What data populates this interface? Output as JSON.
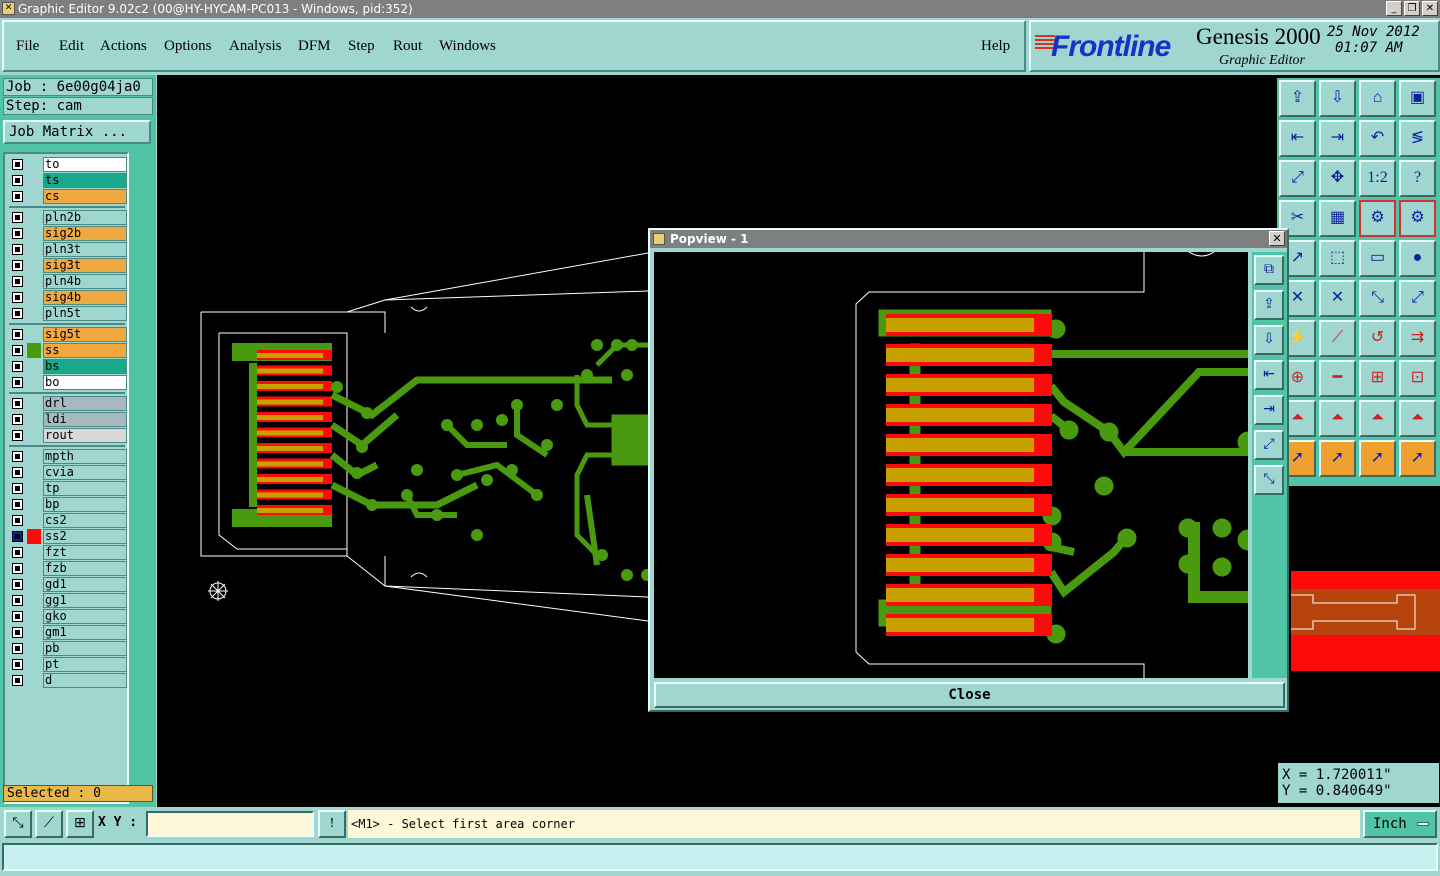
{
  "window": {
    "title": "Graphic Editor 9.02c2 (00@HY-HYCAM-PC013 - Windows, pid:352)"
  },
  "menu": {
    "file": "File",
    "edit": "Edit",
    "actions": "Actions",
    "options": "Options",
    "analysis": "Analysis",
    "dfm": "DFM",
    "step": "Step",
    "rout": "Rout",
    "windows": "Windows",
    "help": "Help"
  },
  "brand": {
    "logo": "Frontline",
    "product": "Genesis 2000",
    "subtitle": "Graphic Editor",
    "date": "25 Nov 2012",
    "time": "01:07 AM"
  },
  "job": {
    "job_label": "Job : 6e00g04ja0",
    "step_label": "Step: cam",
    "matrix_button": "Job Matrix ..."
  },
  "layers": [
    {
      "name": "to",
      "color": "#ffffff",
      "mark": ""
    },
    {
      "name": "ts",
      "color": "#1aa88a",
      "mark": ""
    },
    {
      "name": "cs",
      "color": "#f0a840",
      "mark": "✎"
    },
    {
      "name": "pln2b",
      "color": "#9fd6d0",
      "mark": ""
    },
    {
      "name": "sig2b",
      "color": "#f0a840",
      "mark": "✎"
    },
    {
      "name": "pln3t",
      "color": "#9fd6d0",
      "mark": ""
    },
    {
      "name": "sig3t",
      "color": "#f0a840",
      "mark": ""
    },
    {
      "name": "pln4b",
      "color": "#9fd6d0",
      "mark": ""
    },
    {
      "name": "sig4b",
      "color": "#f0a840",
      "mark": ""
    },
    {
      "name": "pln5t",
      "color": "#9fd6d0",
      "mark": ""
    },
    {
      "name": "sig5t",
      "color": "#f0a840",
      "mark": "✎"
    },
    {
      "name": "ss",
      "color": "#f0a840",
      "mark": ""
    },
    {
      "name": "bs",
      "color": "#1aa88a",
      "mark": ""
    },
    {
      "name": "bo",
      "color": "#ffffff",
      "mark": "✎"
    },
    {
      "name": "drl",
      "color": "#a8b8c0",
      "mark": ""
    },
    {
      "name": "ldi",
      "color": "#a8b8c0",
      "mark": ""
    },
    {
      "name": "rout",
      "color": "#d8d8d8",
      "mark": ""
    },
    {
      "name": "mpth",
      "color": "#9fd6d0",
      "mark": ""
    },
    {
      "name": "cvia",
      "color": "#9fd6d0",
      "mark": ""
    },
    {
      "name": "tp",
      "color": "#9fd6d0",
      "mark": ""
    },
    {
      "name": "bp",
      "color": "#9fd6d0",
      "mark": ""
    },
    {
      "name": "cs2",
      "color": "#9fd6d0",
      "mark": ""
    },
    {
      "name": "ss2",
      "color": "#9fd6d0",
      "mark": "▣"
    },
    {
      "name": "fzt",
      "color": "#9fd6d0",
      "mark": ""
    },
    {
      "name": "fzb",
      "color": "#9fd6d0",
      "mark": ""
    },
    {
      "name": "gd1",
      "color": "#9fd6d0",
      "mark": "✎"
    },
    {
      "name": "gg1",
      "color": "#9fd6d0",
      "mark": ""
    },
    {
      "name": "gko",
      "color": "#9fd6d0",
      "mark": ""
    },
    {
      "name": "gm1",
      "color": "#9fd6d0",
      "mark": ""
    },
    {
      "name": "pb",
      "color": "#9fd6d0",
      "mark": ""
    },
    {
      "name": "pt",
      "color": "#9fd6d0",
      "mark": ""
    },
    {
      "name": "d",
      "color": "#9fd6d0",
      "mark": ""
    }
  ],
  "selected": "Selected : 0",
  "popview": {
    "title": "Popview - 1",
    "close_button": "Close"
  },
  "coords": {
    "x": "X = 1.720011\"",
    "y": "Y = 0.840649\""
  },
  "bottom": {
    "xy_label": "X Y :",
    "xy_value": "",
    "prompt": "<M1> - Select first area corner",
    "unit": "Inch"
  },
  "colors": {
    "copper": "#4a9a10",
    "pad_red": "#ff0a0a",
    "pad_gold": "#c8a000",
    "outline": "#ffffff"
  }
}
